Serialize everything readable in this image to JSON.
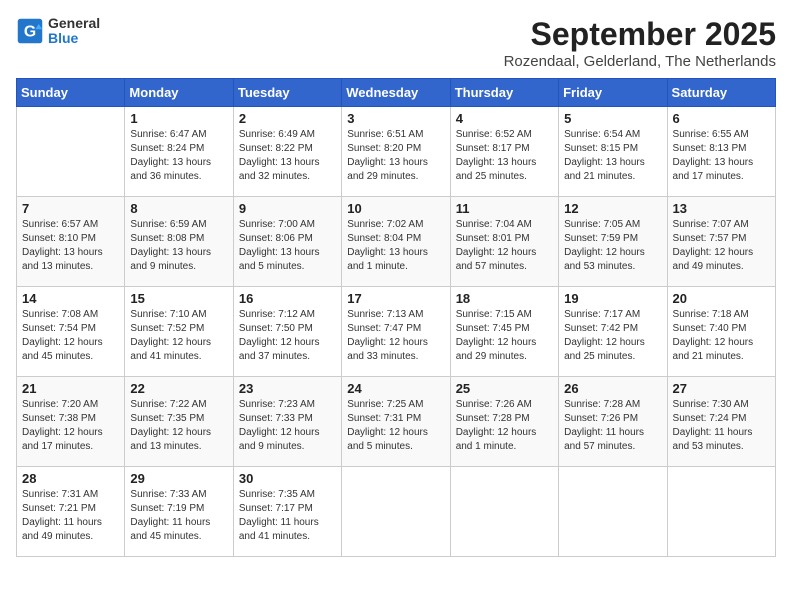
{
  "header": {
    "logo_line1": "General",
    "logo_line2": "Blue",
    "month_title": "September 2025",
    "location": "Rozendaal, Gelderland, The Netherlands"
  },
  "days_of_week": [
    "Sunday",
    "Monday",
    "Tuesday",
    "Wednesday",
    "Thursday",
    "Friday",
    "Saturday"
  ],
  "weeks": [
    [
      {
        "day": "",
        "info": ""
      },
      {
        "day": "1",
        "info": "Sunrise: 6:47 AM\nSunset: 8:24 PM\nDaylight: 13 hours\nand 36 minutes."
      },
      {
        "day": "2",
        "info": "Sunrise: 6:49 AM\nSunset: 8:22 PM\nDaylight: 13 hours\nand 32 minutes."
      },
      {
        "day": "3",
        "info": "Sunrise: 6:51 AM\nSunset: 8:20 PM\nDaylight: 13 hours\nand 29 minutes."
      },
      {
        "day": "4",
        "info": "Sunrise: 6:52 AM\nSunset: 8:17 PM\nDaylight: 13 hours\nand 25 minutes."
      },
      {
        "day": "5",
        "info": "Sunrise: 6:54 AM\nSunset: 8:15 PM\nDaylight: 13 hours\nand 21 minutes."
      },
      {
        "day": "6",
        "info": "Sunrise: 6:55 AM\nSunset: 8:13 PM\nDaylight: 13 hours\nand 17 minutes."
      }
    ],
    [
      {
        "day": "7",
        "info": "Sunrise: 6:57 AM\nSunset: 8:10 PM\nDaylight: 13 hours\nand 13 minutes."
      },
      {
        "day": "8",
        "info": "Sunrise: 6:59 AM\nSunset: 8:08 PM\nDaylight: 13 hours\nand 9 minutes."
      },
      {
        "day": "9",
        "info": "Sunrise: 7:00 AM\nSunset: 8:06 PM\nDaylight: 13 hours\nand 5 minutes."
      },
      {
        "day": "10",
        "info": "Sunrise: 7:02 AM\nSunset: 8:04 PM\nDaylight: 13 hours\nand 1 minute."
      },
      {
        "day": "11",
        "info": "Sunrise: 7:04 AM\nSunset: 8:01 PM\nDaylight: 12 hours\nand 57 minutes."
      },
      {
        "day": "12",
        "info": "Sunrise: 7:05 AM\nSunset: 7:59 PM\nDaylight: 12 hours\nand 53 minutes."
      },
      {
        "day": "13",
        "info": "Sunrise: 7:07 AM\nSunset: 7:57 PM\nDaylight: 12 hours\nand 49 minutes."
      }
    ],
    [
      {
        "day": "14",
        "info": "Sunrise: 7:08 AM\nSunset: 7:54 PM\nDaylight: 12 hours\nand 45 minutes."
      },
      {
        "day": "15",
        "info": "Sunrise: 7:10 AM\nSunset: 7:52 PM\nDaylight: 12 hours\nand 41 minutes."
      },
      {
        "day": "16",
        "info": "Sunrise: 7:12 AM\nSunset: 7:50 PM\nDaylight: 12 hours\nand 37 minutes."
      },
      {
        "day": "17",
        "info": "Sunrise: 7:13 AM\nSunset: 7:47 PM\nDaylight: 12 hours\nand 33 minutes."
      },
      {
        "day": "18",
        "info": "Sunrise: 7:15 AM\nSunset: 7:45 PM\nDaylight: 12 hours\nand 29 minutes."
      },
      {
        "day": "19",
        "info": "Sunrise: 7:17 AM\nSunset: 7:42 PM\nDaylight: 12 hours\nand 25 minutes."
      },
      {
        "day": "20",
        "info": "Sunrise: 7:18 AM\nSunset: 7:40 PM\nDaylight: 12 hours\nand 21 minutes."
      }
    ],
    [
      {
        "day": "21",
        "info": "Sunrise: 7:20 AM\nSunset: 7:38 PM\nDaylight: 12 hours\nand 17 minutes."
      },
      {
        "day": "22",
        "info": "Sunrise: 7:22 AM\nSunset: 7:35 PM\nDaylight: 12 hours\nand 13 minutes."
      },
      {
        "day": "23",
        "info": "Sunrise: 7:23 AM\nSunset: 7:33 PM\nDaylight: 12 hours\nand 9 minutes."
      },
      {
        "day": "24",
        "info": "Sunrise: 7:25 AM\nSunset: 7:31 PM\nDaylight: 12 hours\nand 5 minutes."
      },
      {
        "day": "25",
        "info": "Sunrise: 7:26 AM\nSunset: 7:28 PM\nDaylight: 12 hours\nand 1 minute."
      },
      {
        "day": "26",
        "info": "Sunrise: 7:28 AM\nSunset: 7:26 PM\nDaylight: 11 hours\nand 57 minutes."
      },
      {
        "day": "27",
        "info": "Sunrise: 7:30 AM\nSunset: 7:24 PM\nDaylight: 11 hours\nand 53 minutes."
      }
    ],
    [
      {
        "day": "28",
        "info": "Sunrise: 7:31 AM\nSunset: 7:21 PM\nDaylight: 11 hours\nand 49 minutes."
      },
      {
        "day": "29",
        "info": "Sunrise: 7:33 AM\nSunset: 7:19 PM\nDaylight: 11 hours\nand 45 minutes."
      },
      {
        "day": "30",
        "info": "Sunrise: 7:35 AM\nSunset: 7:17 PM\nDaylight: 11 hours\nand 41 minutes."
      },
      {
        "day": "",
        "info": ""
      },
      {
        "day": "",
        "info": ""
      },
      {
        "day": "",
        "info": ""
      },
      {
        "day": "",
        "info": ""
      }
    ]
  ]
}
